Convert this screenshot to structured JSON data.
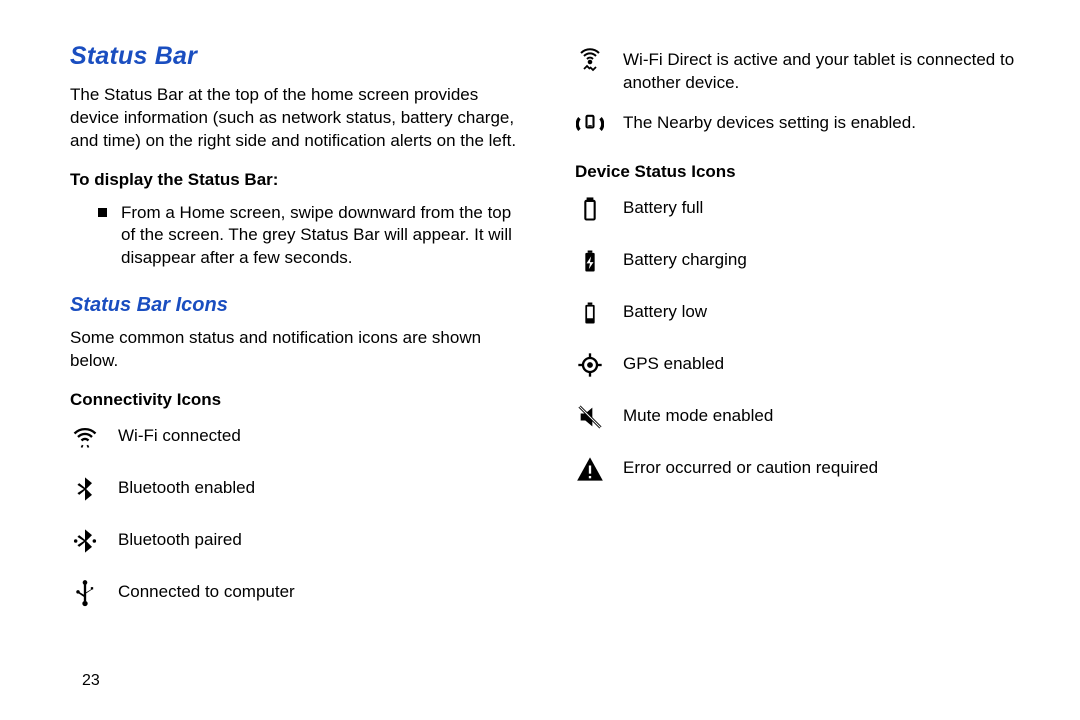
{
  "page_number": "23",
  "left": {
    "title": "Status Bar",
    "intro": "The Status Bar at the top of the home screen provides device information (such as network status, battery charge, and time) on the right side and notification alerts on the left.",
    "display_heading": "To display the Status Bar:",
    "display_bullet": "From a Home screen, swipe downward from the top of the screen. The grey Status Bar will appear. It will disappear after a few seconds.",
    "icons_title": "Status Bar Icons",
    "icons_intro": "Some common status and notification icons are shown below.",
    "connectivity_heading": "Connectivity Icons",
    "connectivity": [
      {
        "name": "wifi-icon",
        "label": "Wi-Fi connected"
      },
      {
        "name": "bluetooth-icon",
        "label": "Bluetooth enabled"
      },
      {
        "name": "bluetooth-paired-icon",
        "label": "Bluetooth paired"
      },
      {
        "name": "usb-icon",
        "label": "Connected to computer"
      }
    ]
  },
  "right": {
    "top_icons": [
      {
        "name": "wifi-direct-icon",
        "label": "Wi-Fi Direct is active and your tablet is connected to another device."
      },
      {
        "name": "nearby-devices-icon",
        "label": "The Nearby devices setting is enabled."
      }
    ],
    "device_heading": "Device Status Icons",
    "device": [
      {
        "name": "battery-full-icon",
        "label": "Battery full"
      },
      {
        "name": "battery-charging-icon",
        "label": "Battery charging"
      },
      {
        "name": "battery-low-icon",
        "label": "Battery low"
      },
      {
        "name": "gps-icon",
        "label": "GPS enabled"
      },
      {
        "name": "mute-icon",
        "label": "Mute mode enabled"
      },
      {
        "name": "warning-icon",
        "label": "Error occurred or caution required"
      }
    ]
  }
}
